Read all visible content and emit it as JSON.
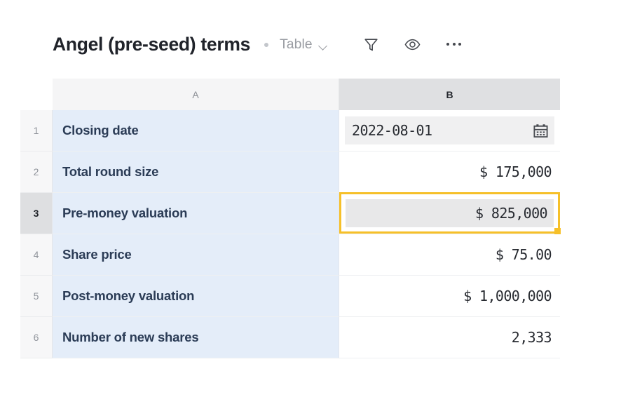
{
  "header": {
    "title": "Angel (pre-seed) terms",
    "separator_icon": "bullet-dot-icon",
    "view_switch": {
      "label": "Table",
      "chevron_icon": "chevron-down-icon"
    },
    "tools": [
      {
        "name": "filter-icon",
        "label": "Filter"
      },
      {
        "name": "eye-icon",
        "label": "Hide fields"
      },
      {
        "name": "more-options-icon",
        "label": "More options"
      }
    ]
  },
  "grid": {
    "columns": [
      {
        "id": "A",
        "label": "A",
        "selected": false
      },
      {
        "id": "B",
        "label": "B",
        "selected": true
      }
    ],
    "active_cell": "B3",
    "rows": [
      {
        "number": "1",
        "label": "Closing date",
        "value": "2022-08-01",
        "type": "date",
        "icon": "calendar-icon",
        "selected": false,
        "active_row": false
      },
      {
        "number": "2",
        "label": "Total round size",
        "value": "$ 175,000",
        "type": "currency",
        "selected": false,
        "active_row": false
      },
      {
        "number": "3",
        "label": "Pre-money valuation",
        "value": "$ 825,000",
        "type": "currency",
        "selected": true,
        "active_row": true
      },
      {
        "number": "4",
        "label": "Share price",
        "value": "$ 75.00",
        "type": "currency",
        "selected": false,
        "active_row": false
      },
      {
        "number": "5",
        "label": "Post-money valuation",
        "value": "$ 1,000,000",
        "type": "currency",
        "selected": false,
        "active_row": false
      },
      {
        "number": "6",
        "label": "Number of new shares",
        "value": "2,333",
        "type": "number",
        "selected": false,
        "active_row": false
      }
    ]
  },
  "colors": {
    "selection": "#f6c029",
    "label_column_bg": "#e4edf9",
    "label_text": "#2b3c56",
    "active_header_bg": "#dfe0e2"
  }
}
